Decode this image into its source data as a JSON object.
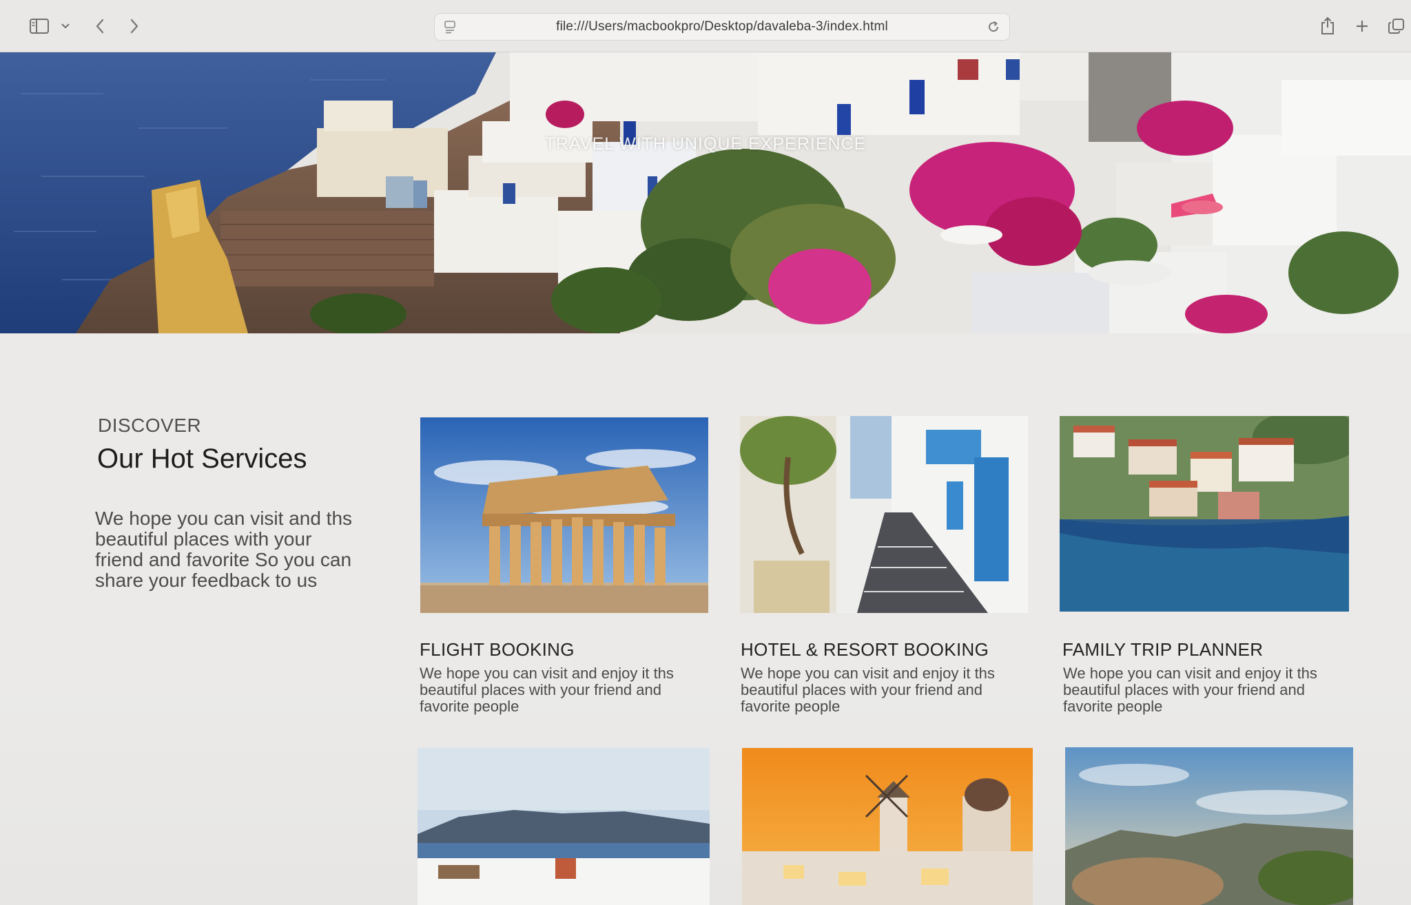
{
  "browser": {
    "url": "file:///Users/macbookpro/Desktop/davaleba-3/index.html",
    "icons": [
      "sidebar-icon",
      "chevron-down-icon",
      "back-arrow-icon",
      "forward-arrow-icon",
      "page-icon",
      "reload-icon",
      "share-icon",
      "plus-icon",
      "tabs-icon"
    ]
  },
  "hero": {
    "tagline": "TRAVEL WITH UNIQUE EXPERIENCE"
  },
  "services": {
    "eyebrow": "DISCOVER",
    "title": "Our Hot Services",
    "description": "We hope you can visit and ths beautiful places with your friend and favorite So you can share your feedback to us",
    "cards": [
      {
        "title": "FLIGHT BOOKING",
        "description": "We hope you can visit and enjoy it ths beautiful places with your friend and favorite people"
      },
      {
        "title": "HOTEL & RESORT BOOKING",
        "description": "We hope you can visit and enjoy it ths beautiful places with your friend and favorite people"
      },
      {
        "title": "FAMILY TRIP PLANNER",
        "description": "We hope you can visit and enjoy it ths beautiful places with your friend and favorite people"
      }
    ]
  },
  "colors": {
    "page_bg": "#ecebea",
    "chrome_bg": "#e9e8e7",
    "sea": "#2d4f8e",
    "whitewash": "#f1f1ef",
    "bougainvillea": "#c8237a"
  }
}
